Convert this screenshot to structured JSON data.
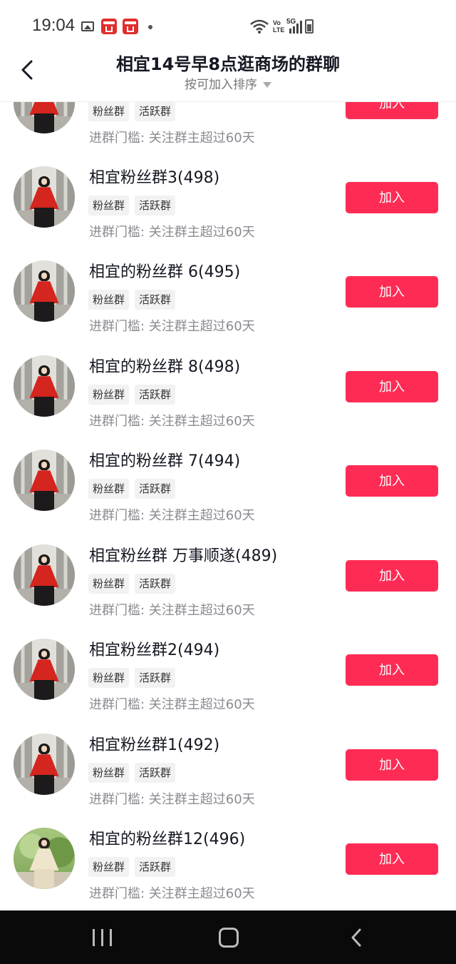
{
  "status_bar": {
    "time": "19:04",
    "icons": [
      "gallery-icon",
      "app-notification-icon",
      "app-notification-icon",
      "dot-icon",
      "wifi-icon",
      "volte-icon",
      "signal-5g-icon",
      "battery-icon"
    ],
    "volte_text_1": "Vo",
    "volte_text_2": "LTE",
    "network": "5G"
  },
  "header": {
    "title": "相宜14号早8点逛商场的群聊",
    "sort_label": "按可加入排序",
    "back_icon": "chevron-left-icon"
  },
  "groups": [
    {
      "name": "",
      "tags": [
        "粉丝群",
        "活跃群"
      ],
      "threshold": "进群门槛: 关注群主超过60天",
      "button": "加入",
      "avatar": "woman-red-coat"
    },
    {
      "name": "相宜粉丝群3(498)",
      "tags": [
        "粉丝群",
        "活跃群"
      ],
      "threshold": "进群门槛: 关注群主超过60天",
      "button": "加入",
      "avatar": "woman-red-coat"
    },
    {
      "name": "相宜的粉丝群 6(495)",
      "tags": [
        "粉丝群",
        "活跃群"
      ],
      "threshold": "进群门槛: 关注群主超过60天",
      "button": "加入",
      "avatar": "woman-red-coat"
    },
    {
      "name": "相宜的粉丝群 8(498)",
      "tags": [
        "粉丝群",
        "活跃群"
      ],
      "threshold": "进群门槛: 关注群主超过60天",
      "button": "加入",
      "avatar": "woman-red-coat"
    },
    {
      "name": "相宜的粉丝群 7(494)",
      "tags": [
        "粉丝群",
        "活跃群"
      ],
      "threshold": "进群门槛: 关注群主超过60天",
      "button": "加入",
      "avatar": "woman-red-coat"
    },
    {
      "name": "相宜粉丝群 万事顺遂(489)",
      "tags": [
        "粉丝群",
        "活跃群"
      ],
      "threshold": "进群门槛: 关注群主超过60天",
      "button": "加入",
      "avatar": "woman-red-coat"
    },
    {
      "name": "相宜粉丝群2(494)",
      "tags": [
        "粉丝群",
        "活跃群"
      ],
      "threshold": "进群门槛: 关注群主超过60天",
      "button": "加入",
      "avatar": "woman-red-coat"
    },
    {
      "name": "相宜粉丝群1(492)",
      "tags": [
        "粉丝群",
        "活跃群"
      ],
      "threshold": "进群门槛: 关注群主超过60天",
      "button": "加入",
      "avatar": "woman-red-coat"
    },
    {
      "name": "相宜的粉丝群12(496)",
      "tags": [
        "粉丝群",
        "活跃群"
      ],
      "threshold": "进群门槛: 关注群主超过60天",
      "button": "加入",
      "avatar": "woman-outdoors"
    }
  ],
  "nav_bar": {
    "icons": [
      "recents-icon",
      "home-icon",
      "back-icon"
    ]
  },
  "colors": {
    "join_button": "#fe2c55",
    "title_text": "#161823",
    "secondary_text": "#8a8b91",
    "nav_background": "#0a0a0a"
  }
}
